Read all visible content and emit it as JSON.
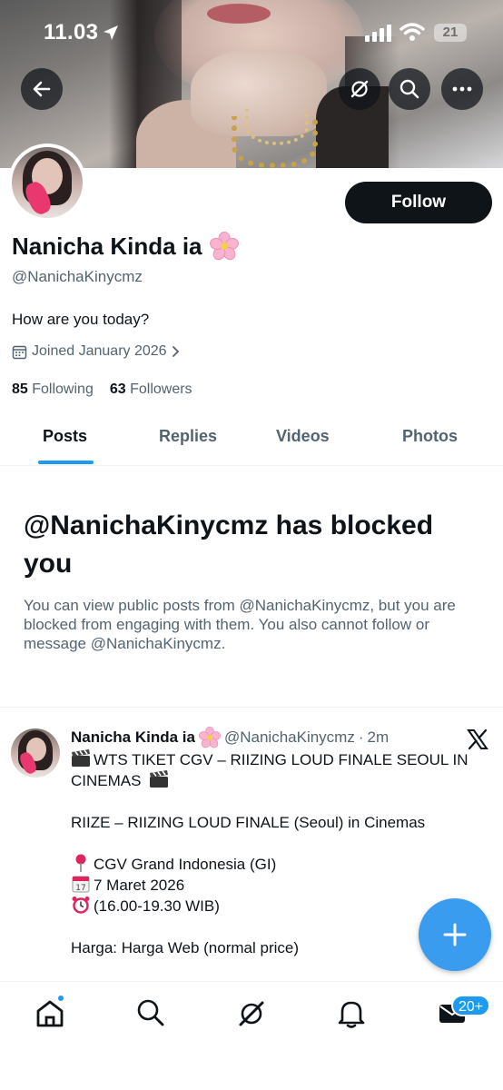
{
  "status_bar": {
    "time": "11.03",
    "battery": "21"
  },
  "profile": {
    "follow_label": "Follow",
    "name": "Nanicha Kinda ia",
    "name_emoji": "cherry-blossom",
    "handle": "@NanichaKinycmz",
    "bio": "How are you today?",
    "joined": "Joined January 2026",
    "following_count": "85",
    "following_label": "Following",
    "followers_count": "63",
    "followers_label": "Followers"
  },
  "tabs": [
    {
      "label": "Posts",
      "active": true
    },
    {
      "label": "Replies",
      "active": false
    },
    {
      "label": "Videos",
      "active": false
    },
    {
      "label": "Photos",
      "active": false
    }
  ],
  "blocked": {
    "title": "@NanichaKinycmz has blocked you",
    "description": "You can view public posts from @NanichaKinycmz, but you are blocked from engaging with them. You also cannot follow or message @NanichaKinycmz."
  },
  "post": {
    "author_name": "Nanicha Kinda ia",
    "author_handle": "@NanichaKinycmz",
    "separator": "·",
    "time": "2m",
    "line1": "WTS TIKET CGV – RIIZING LOUD FINALE SEOUL IN CINEMAS",
    "line2": "RIIZE – RIIZING LOUD FINALE (Seoul) in Cinemas",
    "location": "CGV Grand Indonesia (GI)",
    "date": "7 Maret 2026",
    "hours": "(16.00-19.30 WIB)",
    "price": "Harga: Harga Web (normal price)"
  },
  "bottom_nav": {
    "messages_badge": "20+"
  },
  "colors": {
    "accent": "#1d9bf0",
    "fab": "#3a9cef",
    "text": "#0f1419",
    "secondary": "#536471"
  }
}
